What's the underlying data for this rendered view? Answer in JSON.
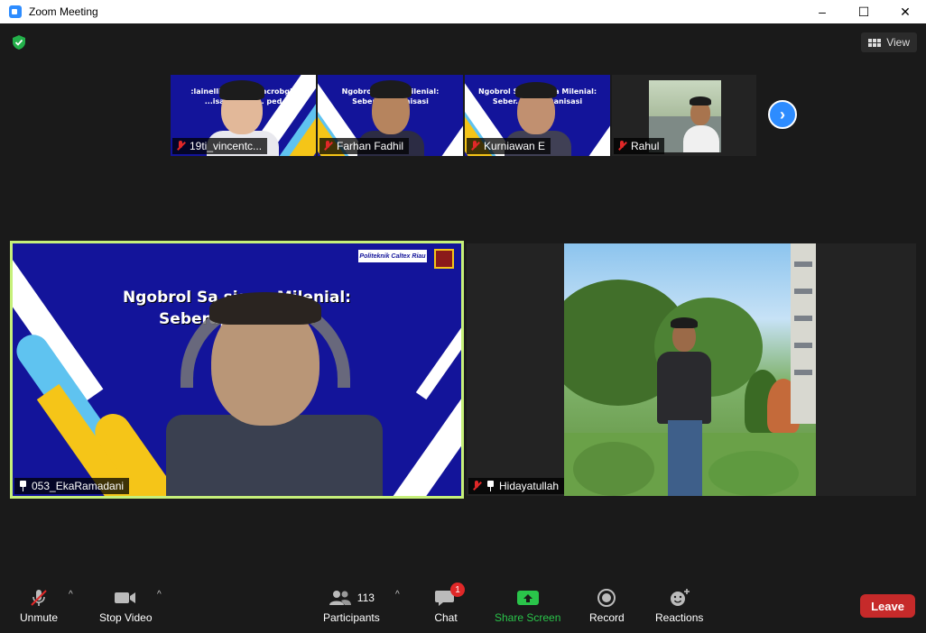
{
  "window": {
    "title": "Zoom Meeting",
    "controls": [
      "–",
      "☐",
      "✕"
    ]
  },
  "top_bar": {
    "view_label": "View"
  },
  "thumbnails": [
    {
      "name": "19ti_vincentc...",
      "slide_text": ":lainelliM awsis...hcrobgN",
      "slide_text2": "...isasinagrO .. ped"
    },
    {
      "name": "Farhan Fadhil",
      "slide_text": "Ngobrol S...wa Milenial:",
      "slide_text2": "Sebera... rganisasi"
    },
    {
      "name": "Kurniawan E",
      "slide_text": "Ngobrol S...hasiswa Milenial:",
      "slide_text2": "Seber... Berorganisasi"
    },
    {
      "name": "Rahul"
    }
  ],
  "main_tiles": {
    "left": {
      "name": "053_EkaRamadani",
      "slide_title_1": "Ngobrol Sa          siswa Milenial:",
      "slide_title_2": "Seberap              rganisasi",
      "slide_logo_text": "Politeknik Caltex Riau"
    },
    "right": {
      "name": "Hidayatullah"
    }
  },
  "toolbar": {
    "unmute": "Unmute",
    "stop_video": "Stop Video",
    "participants": "Participants",
    "participants_count": "113",
    "chat": "Chat",
    "chat_badge": "1",
    "share_screen": "Share Screen",
    "record": "Record",
    "reactions": "Reactions",
    "leave": "Leave"
  },
  "colors": {
    "accent_blue": "#2D8CFF",
    "active_speaker_border": "#c6f07a",
    "leave_red": "#c62a2a",
    "share_green": "#2ac44a"
  }
}
